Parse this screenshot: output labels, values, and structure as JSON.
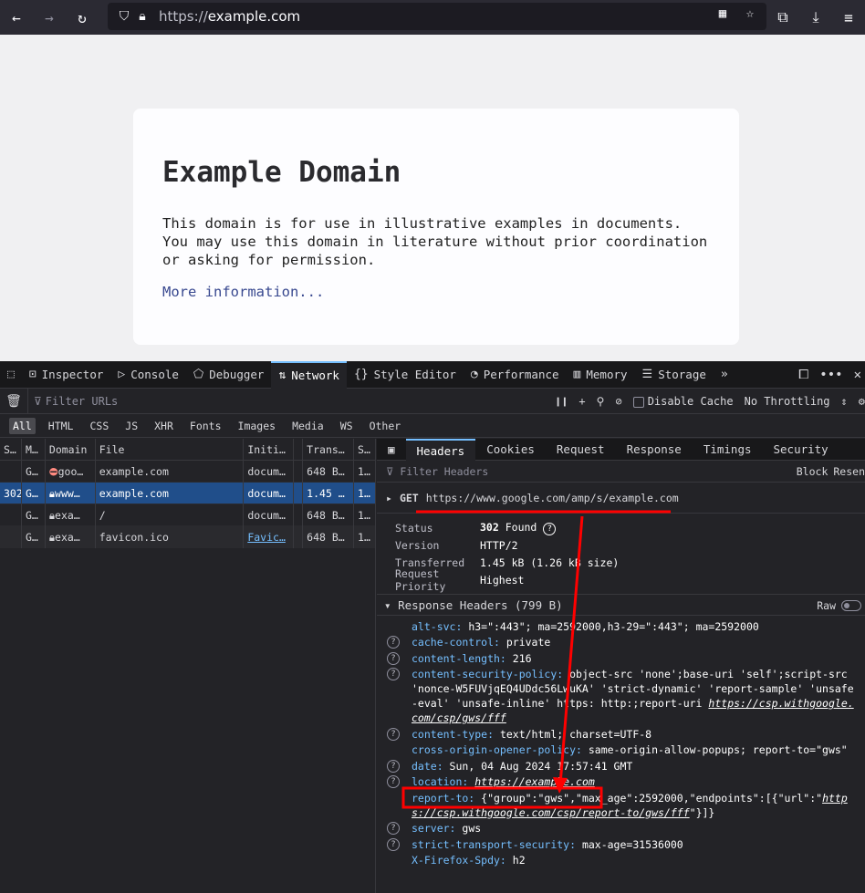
{
  "browser": {
    "url_proto": "https://",
    "url_host": "example.com"
  },
  "page": {
    "title": "Example Domain",
    "description": "This domain is for use in illustrative examples in documents. You may use this domain in literature without prior coordination or asking for permission.",
    "link": "More information..."
  },
  "devtools": {
    "tabs": [
      "Inspector",
      "Console",
      "Debugger",
      "Network",
      "Style Editor",
      "Performance",
      "Memory",
      "Storage"
    ],
    "filter_placeholder": "Filter URLs",
    "disable_cache": "Disable Cache",
    "throttling": "No Throttling",
    "types": [
      "All",
      "HTML",
      "CSS",
      "JS",
      "XHR",
      "Fonts",
      "Images",
      "Media",
      "WS",
      "Other"
    ],
    "columns": [
      "S…",
      "M…",
      "Domain",
      "File",
      "Initi…",
      "Trans…",
      "S…"
    ],
    "rows": [
      {
        "status": "",
        "method": "G…",
        "domain": "goo…",
        "file": "example.com",
        "init": "docum…",
        "trans": "648 B…",
        "size": "1…"
      },
      {
        "status": "302",
        "method": "G…",
        "domain": "www…",
        "file": "example.com",
        "init": "docum…",
        "trans": "1.45 …",
        "size": "1…"
      },
      {
        "status": "",
        "method": "G…",
        "domain": "exa…",
        "file": "/",
        "init": "docum…",
        "trans": "648 B…",
        "size": "1…"
      },
      {
        "status": "",
        "method": "G…",
        "domain": "exa…",
        "file": "favicon.ico",
        "init": "Favic…",
        "trans": "648 B…",
        "size": "1…"
      }
    ],
    "detail_tabs": [
      "Headers",
      "Cookies",
      "Request",
      "Response",
      "Timings",
      "Security"
    ],
    "filter_headers": "Filter Headers",
    "block": "Block",
    "resend": "Resen",
    "get_method": "GET",
    "get_url": "https://www.google.com/amp/s/example.com",
    "summary": {
      "status_label": "Status",
      "status_code": "302",
      "status_text": "Found",
      "version_label": "Version",
      "version": "HTTP/2",
      "transferred_label": "Transferred",
      "transferred": "1.45 kB (1.26 kB size)",
      "priority_label": "Request Priority",
      "priority": "Highest"
    },
    "response_headers_title": "Response Headers (799 B)",
    "raw": "Raw",
    "headers": [
      {
        "name": "alt-svc:",
        "value": " h3=\":443\"; ma=2592000,h3-29=\":443\"; ma=2592000",
        "q": false
      },
      {
        "name": "cache-control:",
        "value": " private",
        "q": true
      },
      {
        "name": "content-length:",
        "value": " 216",
        "q": true
      },
      {
        "name": "content-security-policy:",
        "value": " object-src 'none';base-uri 'self';script-src 'nonce-W5FUVjqEQ4UDdc56LwuKA' 'strict-dynamic' 'report-sample' 'unsafe-eval' 'unsafe-inline' https: http:;report-uri ",
        "link": "https://csp.withgoogle.com/csp/gws/fff",
        "q": true
      },
      {
        "name": "content-type:",
        "value": " text/html; charset=UTF-8",
        "q": true
      },
      {
        "name": "cross-origin-opener-policy:",
        "value": " same-origin-allow-popups; report-to=\"gws\"",
        "q": false
      },
      {
        "name": "date:",
        "value": " Sun, 04 Aug 2024 17:57:41 GMT",
        "q": true
      },
      {
        "name": "location:",
        "value": " ",
        "link": "https://example.com",
        "q": true
      },
      {
        "name": "report-to:",
        "value": " {\"group\":\"gws\",\"max_age\":2592000,\"endpoints\":[{\"url\":\"",
        "link": "https://csp.withgoogle.com/csp/report-to/gws/fff",
        "tail": "\"}]}",
        "q": false
      },
      {
        "name": "server:",
        "value": " gws",
        "q": true
      },
      {
        "name": "strict-transport-security:",
        "value": " max-age=31536000",
        "q": true
      },
      {
        "name": "X-Firefox-Spdy:",
        "value": " h2",
        "q": false
      }
    ]
  },
  "colors": {
    "annotation": "#ff0000",
    "accent": "#75bfff",
    "selected_row": "#204e8a"
  }
}
